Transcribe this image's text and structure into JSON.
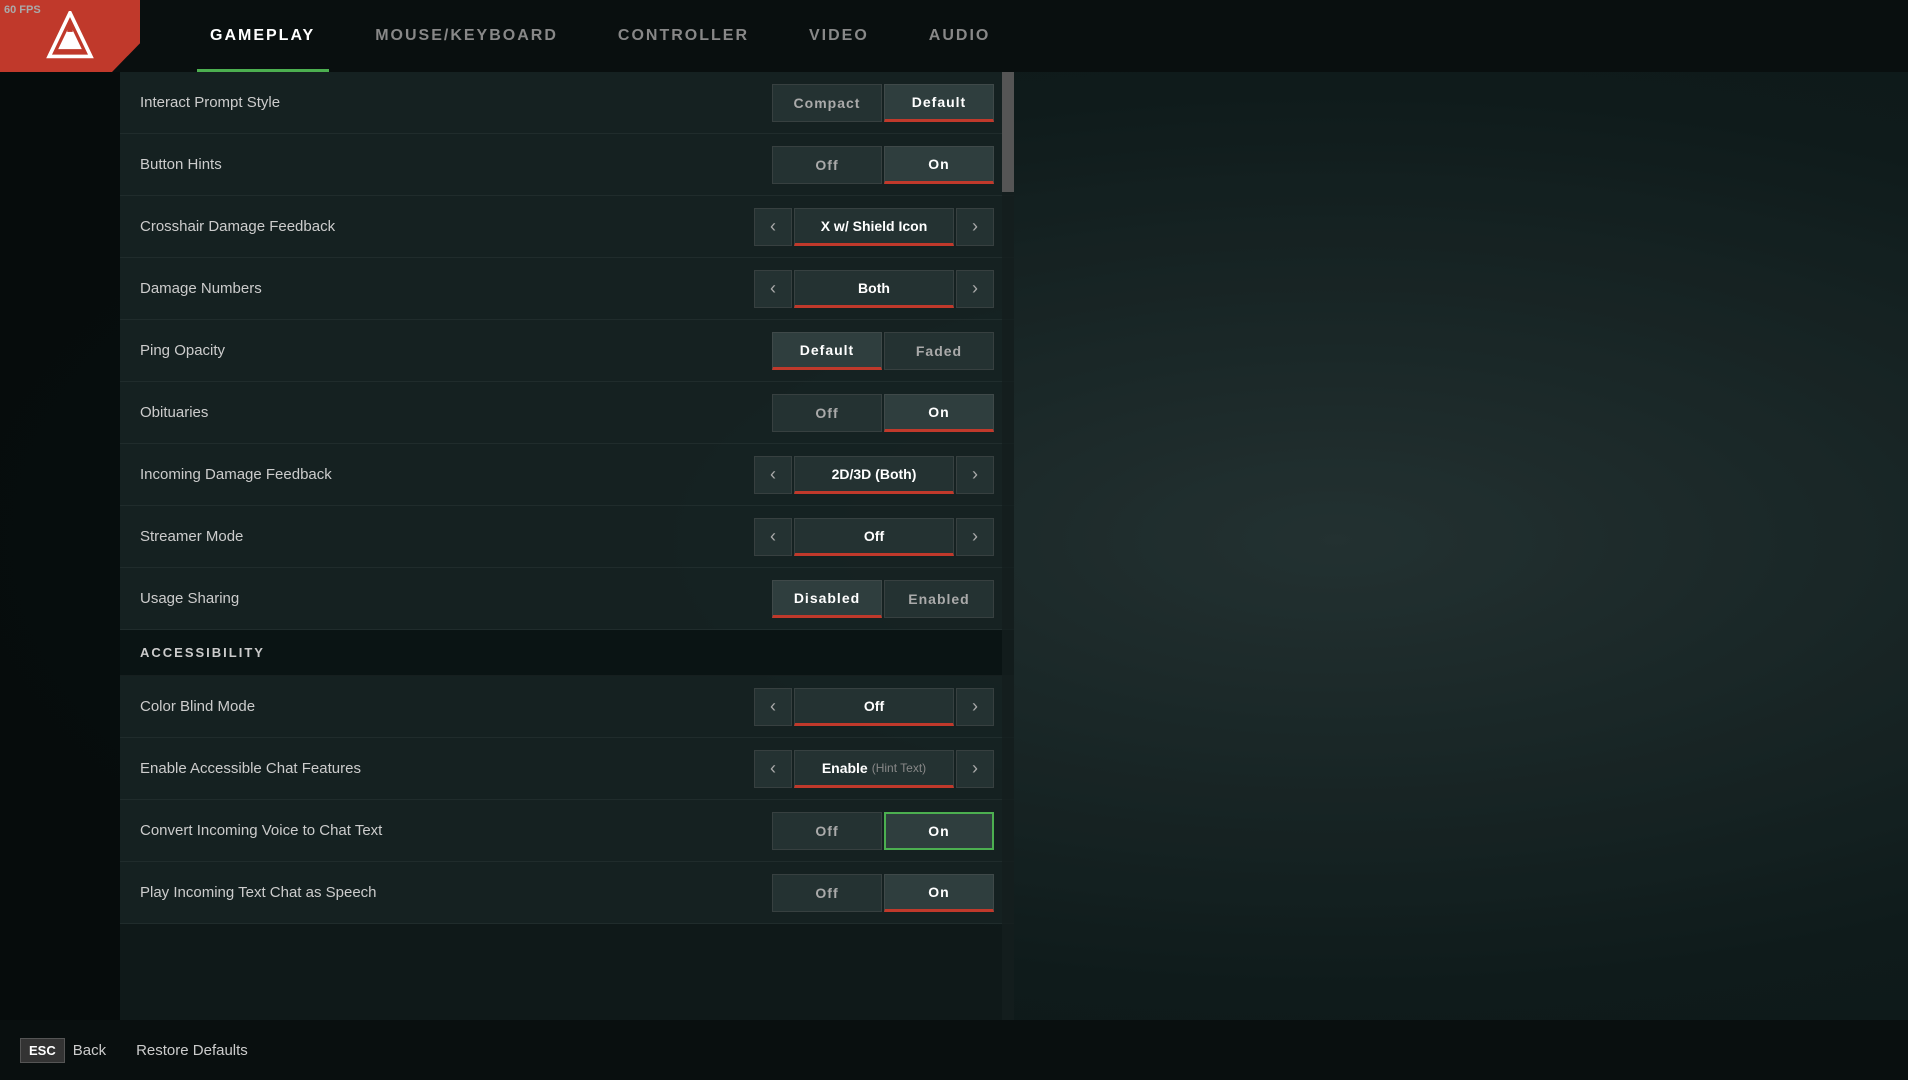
{
  "fps": "60 FPS",
  "nav": {
    "tabs": [
      {
        "id": "gameplay",
        "label": "GAMEPLAY",
        "active": true
      },
      {
        "id": "mouse-keyboard",
        "label": "MOUSE/KEYBOARD",
        "active": false
      },
      {
        "id": "controller",
        "label": "CONTROLLER",
        "active": false
      },
      {
        "id": "video",
        "label": "VIDEO",
        "active": false
      },
      {
        "id": "audio",
        "label": "AUDIO",
        "active": false
      }
    ]
  },
  "settings": {
    "rows": [
      {
        "type": "toggle",
        "label": "Interact Prompt Style",
        "options": [
          "Compact",
          "Default"
        ],
        "active": 1
      },
      {
        "type": "toggle",
        "label": "Button Hints",
        "options": [
          "Off",
          "On"
        ],
        "active": 1
      },
      {
        "type": "chevron",
        "label": "Crosshair Damage Feedback",
        "value": "X w/ Shield Icon"
      },
      {
        "type": "chevron",
        "label": "Damage Numbers",
        "value": "Both"
      },
      {
        "type": "toggle",
        "label": "Ping Opacity",
        "options": [
          "Default",
          "Faded"
        ],
        "active": 0
      },
      {
        "type": "toggle",
        "label": "Obituaries",
        "options": [
          "Off",
          "On"
        ],
        "active": 1
      },
      {
        "type": "chevron",
        "label": "Incoming Damage Feedback",
        "value": "2D/3D (Both)"
      },
      {
        "type": "chevron",
        "label": "Streamer Mode",
        "value": "Off"
      },
      {
        "type": "toggle",
        "label": "Usage Sharing",
        "options": [
          "Disabled",
          "Enabled"
        ],
        "active": 0
      }
    ],
    "accessibility_header": "ACCESSIBILITY",
    "accessibility_rows": [
      {
        "type": "chevron",
        "label": "Color Blind Mode",
        "value": "Off",
        "accent": "red"
      },
      {
        "type": "chevron",
        "label": "Enable Accessible Chat Features",
        "value": "Enable",
        "hint": "(Hint Text)"
      },
      {
        "type": "toggle",
        "label": "Convert Incoming Voice to Chat Text",
        "options": [
          "Off",
          "On"
        ],
        "active": 1,
        "activeStyle": "green"
      },
      {
        "type": "toggle",
        "label": "Play Incoming Text Chat as Speech",
        "options": [
          "Off",
          "On"
        ],
        "active": 1
      }
    ]
  },
  "bottom": {
    "esc_label": "ESC",
    "back_label": "Back",
    "restore_label": "Restore Defaults"
  }
}
